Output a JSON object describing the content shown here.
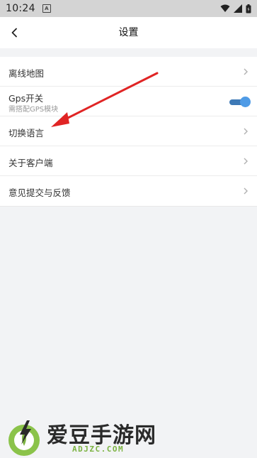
{
  "status_bar": {
    "time": "10:24",
    "notification_icon": "A"
  },
  "header": {
    "title": "设置"
  },
  "settings": {
    "items": [
      {
        "label": "离线地图"
      },
      {
        "label": "Gps开关",
        "sublabel": "需搭配GPS模块",
        "toggle_on": true
      },
      {
        "label": "切换语言"
      },
      {
        "label": "关于客户端"
      },
      {
        "label": "意见提交与反馈"
      }
    ]
  },
  "watermark": {
    "name": "爱豆手游网",
    "domain": "ADJZC.COM"
  },
  "colors": {
    "toggle_track": "#3d79b6",
    "toggle_knob": "#4f9be6",
    "annotation_arrow": "#e02424",
    "watermark_green": "#7cb342"
  }
}
